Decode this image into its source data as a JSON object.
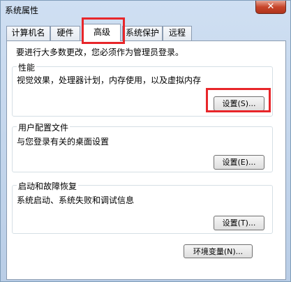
{
  "window": {
    "title": "系统属性",
    "close_label": "✕"
  },
  "tabs": [
    {
      "label": "计算机名"
    },
    {
      "label": "硬件"
    },
    {
      "label": "高级",
      "active": true
    },
    {
      "label": "系统保护"
    },
    {
      "label": "远程"
    }
  ],
  "notice": "要进行大多数更改，您必须作为管理员登录。",
  "groups": {
    "performance": {
      "title": "性能",
      "description": "视觉效果，处理器计划，内存使用，以及虚拟内存",
      "button": "设置(S)..."
    },
    "user_profiles": {
      "title": "用户配置文件",
      "description": "与您登录有关的桌面设置",
      "button": "设置(E)..."
    },
    "startup_recovery": {
      "title": "启动和故障恢复",
      "description": "系统启动、系统失败和调试信息",
      "button": "设置(T)..."
    }
  },
  "env_button": "环境变量(N)...",
  "colors": {
    "highlight": "#e8262a",
    "close_button": "#c7452a"
  }
}
